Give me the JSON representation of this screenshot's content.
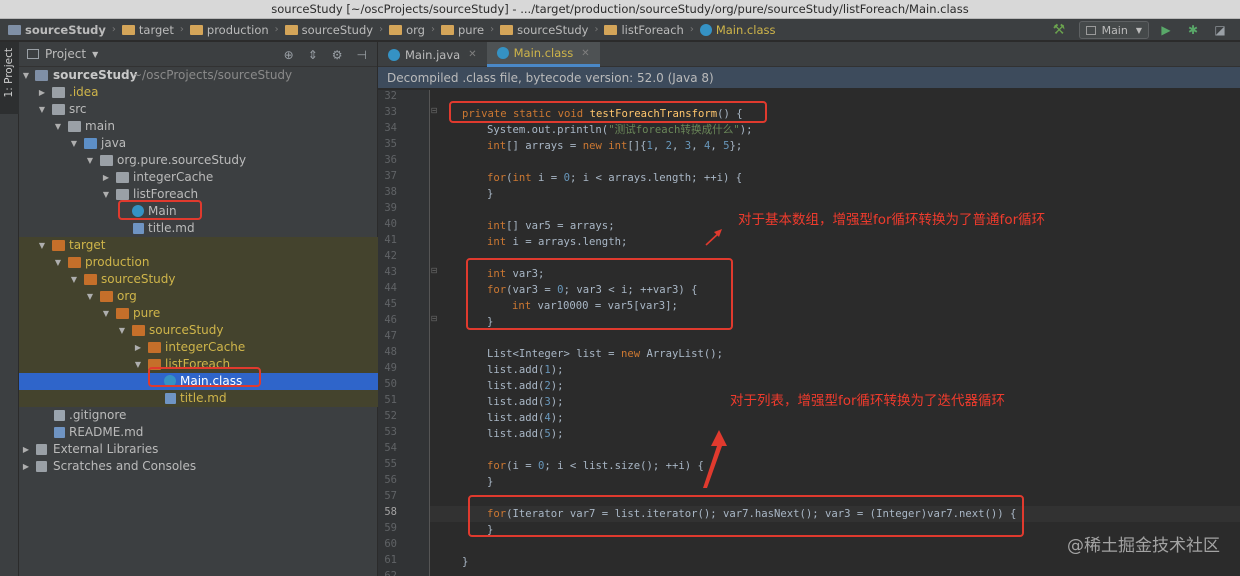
{
  "window": {
    "title": "sourceStudy [~/oscProjects/sourceStudy] - .../target/production/sourceStudy/org/pure/sourceStudy/listForeach/Main.class"
  },
  "navbar": {
    "breadcrumbs": [
      "sourceStudy",
      "target",
      "production",
      "sourceStudy",
      "org",
      "pure",
      "sourceStudy",
      "listForeach",
      "Main.class"
    ],
    "run_config": "Main"
  },
  "left_strip": {
    "tab_label": "1: Project"
  },
  "project_panel": {
    "title": "Project",
    "tree": [
      {
        "label": "sourceStudy",
        "suffix": "~/oscProjects/sourceStudy"
      },
      {
        "label": ".idea"
      },
      {
        "label": "src"
      },
      {
        "label": "main"
      },
      {
        "label": "java"
      },
      {
        "label": "org.pure.sourceStudy"
      },
      {
        "label": "integerCache"
      },
      {
        "label": "listForeach"
      },
      {
        "label": "Main"
      },
      {
        "label": "title.md"
      },
      {
        "label": "target"
      },
      {
        "label": "production"
      },
      {
        "label": "sourceStudy"
      },
      {
        "label": "org"
      },
      {
        "label": "pure"
      },
      {
        "label": "sourceStudy"
      },
      {
        "label": "integerCache"
      },
      {
        "label": "listForeach"
      },
      {
        "label": "Main.class"
      },
      {
        "label": "title.md"
      },
      {
        "label": ".gitignore"
      },
      {
        "label": "README.md"
      },
      {
        "label": "External Libraries"
      },
      {
        "label": "Scratches and Consoles"
      }
    ]
  },
  "editor": {
    "tabs": [
      {
        "label": "Main.java"
      },
      {
        "label": "Main.class"
      }
    ],
    "banner": "Decompiled .class file, bytecode version: 52.0 (Java 8)",
    "line_numbers": [
      "32",
      "33",
      "34",
      "35",
      "36",
      "37",
      "38",
      "39",
      "40",
      "41",
      "42",
      "43",
      "44",
      "45",
      "46",
      "47",
      "48",
      "49",
      "50",
      "51",
      "52",
      "53",
      "54",
      "55",
      "56",
      "57",
      "58",
      "59",
      "60",
      "61",
      "62"
    ],
    "code": {
      "l33_kw": "private static void ",
      "l33_fn": "testForeachTransform",
      "l33_rest": "() {",
      "l34_a": "System.out.println(",
      "l34_str": "\"测试foreach转换成什么\"",
      "l34_b": ");",
      "l35_kw1": "int",
      "l35_a": "[] arrays = ",
      "l35_kw2": "new int",
      "l35_b": "[]{",
      "l35_n1": "1",
      "l35_n2": "2",
      "l35_n3": "3",
      "l35_n4": "4",
      "l35_n5": "5",
      "l35_c": "};",
      "l37_kw1": "for",
      "l37_a": "(",
      "l37_kw2": "int",
      "l37_b": " i = ",
      "l37_n": "0",
      "l37_c": "; i < arrays.length; ++i) {",
      "l38": "}",
      "l40_kw": "int",
      "l40_a": "[] var5 = arrays;",
      "l41_kw": "int",
      "l41_a": " i = arrays.length;",
      "l43_kw": "int",
      "l43_a": " var3;",
      "l44_kw": "for",
      "l44_a": "(var3 = ",
      "l44_n": "0",
      "l44_b": "; var3 < i; ++var3) {",
      "l45_kw": "int",
      "l45_a": " var10000 = var5[var3];",
      "l46": "}",
      "l48_a": "List<Integer> list = ",
      "l48_kw": "new",
      "l48_b": " ArrayList();",
      "add_prefix": "list.add(",
      "add_suffix": ");",
      "adds": [
        "1",
        "2",
        "3",
        "4",
        "5"
      ],
      "l55_kw": "for",
      "l55_a": "(i = ",
      "l55_n": "0",
      "l55_b": "; i < list.size(); ++i) {",
      "l56": "}",
      "l58_kw": "for",
      "l58_a": "(Iterator var7 = list.iterator(); var7.hasNext(); var3 = (Integer)var7.next()) {",
      "l59": "}",
      "l61": "}"
    }
  },
  "annotations": {
    "note_array": "对于基本数组，增强型for循环转换为了普通for循环",
    "note_list": "对于列表，增强型for循环转换为了迭代器循环",
    "color": "#e03a2e"
  },
  "watermark": "@稀土掘金技术社区",
  "colors": {
    "keyword": "#cc7832",
    "function": "#ffc66d",
    "number": "#6897bb",
    "string": "#6a8759",
    "selection": "#2f65ca"
  }
}
